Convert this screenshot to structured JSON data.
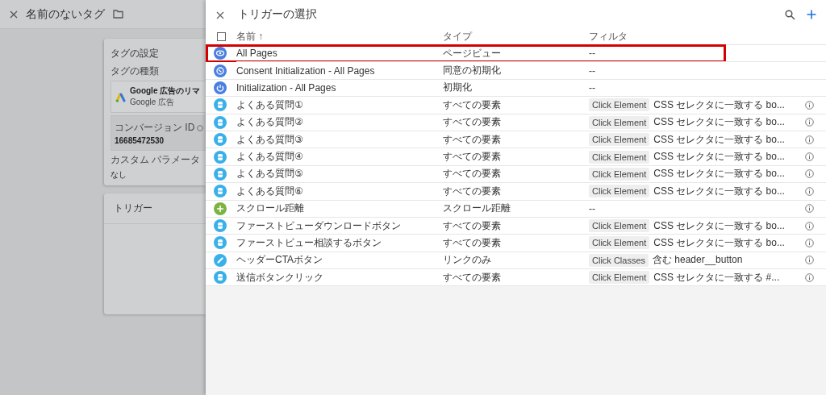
{
  "page": {
    "title": "名前のないタグ",
    "settings_card": {
      "title": "タグの設定",
      "type_label": "タグの種類",
      "tag_name": "Google 広告のリマ",
      "tag_vendor": "Google 広告",
      "conversion_label": "コンバージョン ID",
      "conversion_id": "16685472530",
      "custom_label": "カスタム パラメータ",
      "custom_value": "なし"
    },
    "trigger_card": {
      "title": "トリガー"
    }
  },
  "panel": {
    "title": "トリガーの選択",
    "select_all_checked": false,
    "columns": [
      {
        "label": "名前 ↑"
      },
      {
        "label": "タイプ"
      },
      {
        "label": "フィルタ"
      }
    ],
    "rows": [
      {
        "kind": "pageview",
        "name": "All Pages",
        "type": "ページビュー",
        "filter": "--",
        "highlighted": true,
        "info": false
      },
      {
        "kind": "consent",
        "name": "Consent Initialization - All Pages",
        "type": "同意の初期化",
        "filter": "--",
        "highlighted": false,
        "info": false
      },
      {
        "kind": "init",
        "name": "Initialization - All Pages",
        "type": "初期化",
        "filter": "--",
        "highlighted": false,
        "info": false
      },
      {
        "kind": "click",
        "name": "よくある質問①",
        "type": "すべての要素",
        "filter_chip": "Click Element",
        "filter": "CSS セレクタに一致する bo...",
        "highlighted": false,
        "info": true
      },
      {
        "kind": "click",
        "name": "よくある質問②",
        "type": "すべての要素",
        "filter_chip": "Click Element",
        "filter": "CSS セレクタに一致する bo...",
        "highlighted": false,
        "info": true
      },
      {
        "kind": "click",
        "name": "よくある質問③",
        "type": "すべての要素",
        "filter_chip": "Click Element",
        "filter": "CSS セレクタに一致する bo...",
        "highlighted": false,
        "info": true
      },
      {
        "kind": "click",
        "name": "よくある質問④",
        "type": "すべての要素",
        "filter_chip": "Click Element",
        "filter": "CSS セレクタに一致する bo...",
        "highlighted": false,
        "info": true
      },
      {
        "kind": "click",
        "name": "よくある質問⑤",
        "type": "すべての要素",
        "filter_chip": "Click Element",
        "filter": "CSS セレクタに一致する bo...",
        "highlighted": false,
        "info": true
      },
      {
        "kind": "click",
        "name": "よくある質問⑥",
        "type": "すべての要素",
        "filter_chip": "Click Element",
        "filter": "CSS セレクタに一致する bo...",
        "highlighted": false,
        "info": true
      },
      {
        "kind": "scroll",
        "name": "スクロール距離",
        "type": "スクロール距離",
        "filter": "--",
        "highlighted": false,
        "info": true
      },
      {
        "kind": "click",
        "name": "ファーストビューダウンロードボタン",
        "type": "すべての要素",
        "filter_chip": "Click Element",
        "filter": "CSS セレクタに一致する bo...",
        "highlighted": false,
        "info": true
      },
      {
        "kind": "click",
        "name": "ファーストビュー相談するボタン",
        "type": "すべての要素",
        "filter_chip": "Click Element",
        "filter": "CSS セレクタに一致する bo...",
        "highlighted": false,
        "info": true
      },
      {
        "kind": "link",
        "name": "ヘッダーCTAボタン",
        "type": "リンクのみ",
        "filter_chip": "Click Classes",
        "filter": "含む header__button",
        "highlighted": false,
        "info": true
      },
      {
        "kind": "click",
        "name": "送信ボタンクリック",
        "type": "すべての要素",
        "filter_chip": "Click Element",
        "filter": "CSS セレクタに一致する #...",
        "highlighted": false,
        "info": true
      }
    ]
  }
}
